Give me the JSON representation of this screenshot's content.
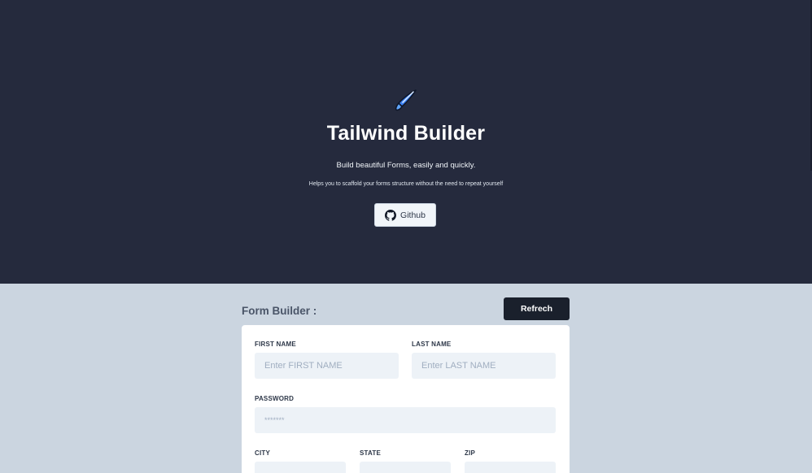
{
  "hero": {
    "logo_icon": "comet-icon",
    "title": "Tailwind Builder",
    "subtitle": "Build beautiful Forms, easily and quickly.",
    "tagline": "Helps you to scaffold your forms structure without the need to repeat yourself",
    "github_button": {
      "icon": "github-icon",
      "label": "Github"
    }
  },
  "form_builder": {
    "heading": "Form Builder :",
    "refresh_label": "Refrech",
    "fields": {
      "first_name": {
        "label": "FIRST NAME",
        "placeholder": "Enter FIRST NAME",
        "value": ""
      },
      "last_name": {
        "label": "LAST NAME",
        "placeholder": "Enter LAST NAME",
        "value": ""
      },
      "password": {
        "label": "PASSWORD",
        "placeholder": "*******",
        "value": ""
      },
      "city": {
        "label": "CITY",
        "value": ""
      },
      "state": {
        "label": "STATE",
        "value": ""
      },
      "zip": {
        "label": "ZIP",
        "value": ""
      }
    }
  },
  "colors": {
    "hero_bg": "#252a3d",
    "page_bg": "#cbd5e0",
    "button_dark": "#1a202c",
    "input_bg": "#edf2f7"
  }
}
